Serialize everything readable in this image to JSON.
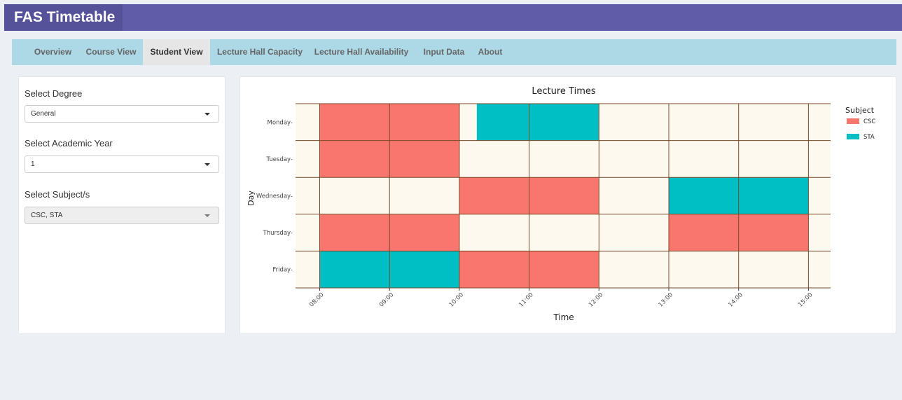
{
  "app": {
    "title": "FAS Timetable"
  },
  "tabs": [
    {
      "label": "Overview",
      "active": false
    },
    {
      "label": "Course View",
      "active": false
    },
    {
      "label": "Student View",
      "active": true
    },
    {
      "label": "Lecture Hall Capacity",
      "active": false
    },
    {
      "label": "Lecture Hall Availability",
      "active": false
    },
    {
      "label": "Input Data",
      "active": false
    },
    {
      "label": "About",
      "active": false
    }
  ],
  "sidebar": {
    "degree": {
      "label": "Select Degree",
      "value": "General"
    },
    "year": {
      "label": "Select Academic Year",
      "value": "1"
    },
    "subjects": {
      "label": "Select Subject/s",
      "value": "CSC, STA"
    }
  },
  "colors": {
    "CSC": "#f8766d",
    "STA": "#00bfc4",
    "panel_bg": "#fdf9ee",
    "grid": "#7a4a2a"
  },
  "chart_data": {
    "type": "gantt",
    "title": "Lecture Times",
    "xlabel": "Time",
    "ylabel": "Day",
    "days": [
      "Monday",
      "Tuesday",
      "Wednesday",
      "Thursday",
      "Friday"
    ],
    "x_ticks": [
      "08:00",
      "09:00",
      "10:00",
      "11:00",
      "12:00",
      "13:00",
      "14:00",
      "15:00"
    ],
    "legend": {
      "title": "Subject",
      "entries": [
        "CSC",
        "STA"
      ],
      "position": "right"
    },
    "bars": [
      {
        "day": "Monday",
        "start": "08:00",
        "end": "10:00",
        "subject": "CSC"
      },
      {
        "day": "Monday",
        "start": "10:15",
        "end": "12:00",
        "subject": "STA"
      },
      {
        "day": "Tuesday",
        "start": "08:00",
        "end": "10:00",
        "subject": "CSC"
      },
      {
        "day": "Wednesday",
        "start": "10:00",
        "end": "12:00",
        "subject": "CSC"
      },
      {
        "day": "Wednesday",
        "start": "13:00",
        "end": "15:00",
        "subject": "STA"
      },
      {
        "day": "Thursday",
        "start": "08:00",
        "end": "10:00",
        "subject": "CSC"
      },
      {
        "day": "Thursday",
        "start": "13:00",
        "end": "15:00",
        "subject": "CSC"
      },
      {
        "day": "Friday",
        "start": "08:00",
        "end": "10:00",
        "subject": "STA"
      },
      {
        "day": "Friday",
        "start": "10:00",
        "end": "12:00",
        "subject": "CSC"
      }
    ]
  }
}
